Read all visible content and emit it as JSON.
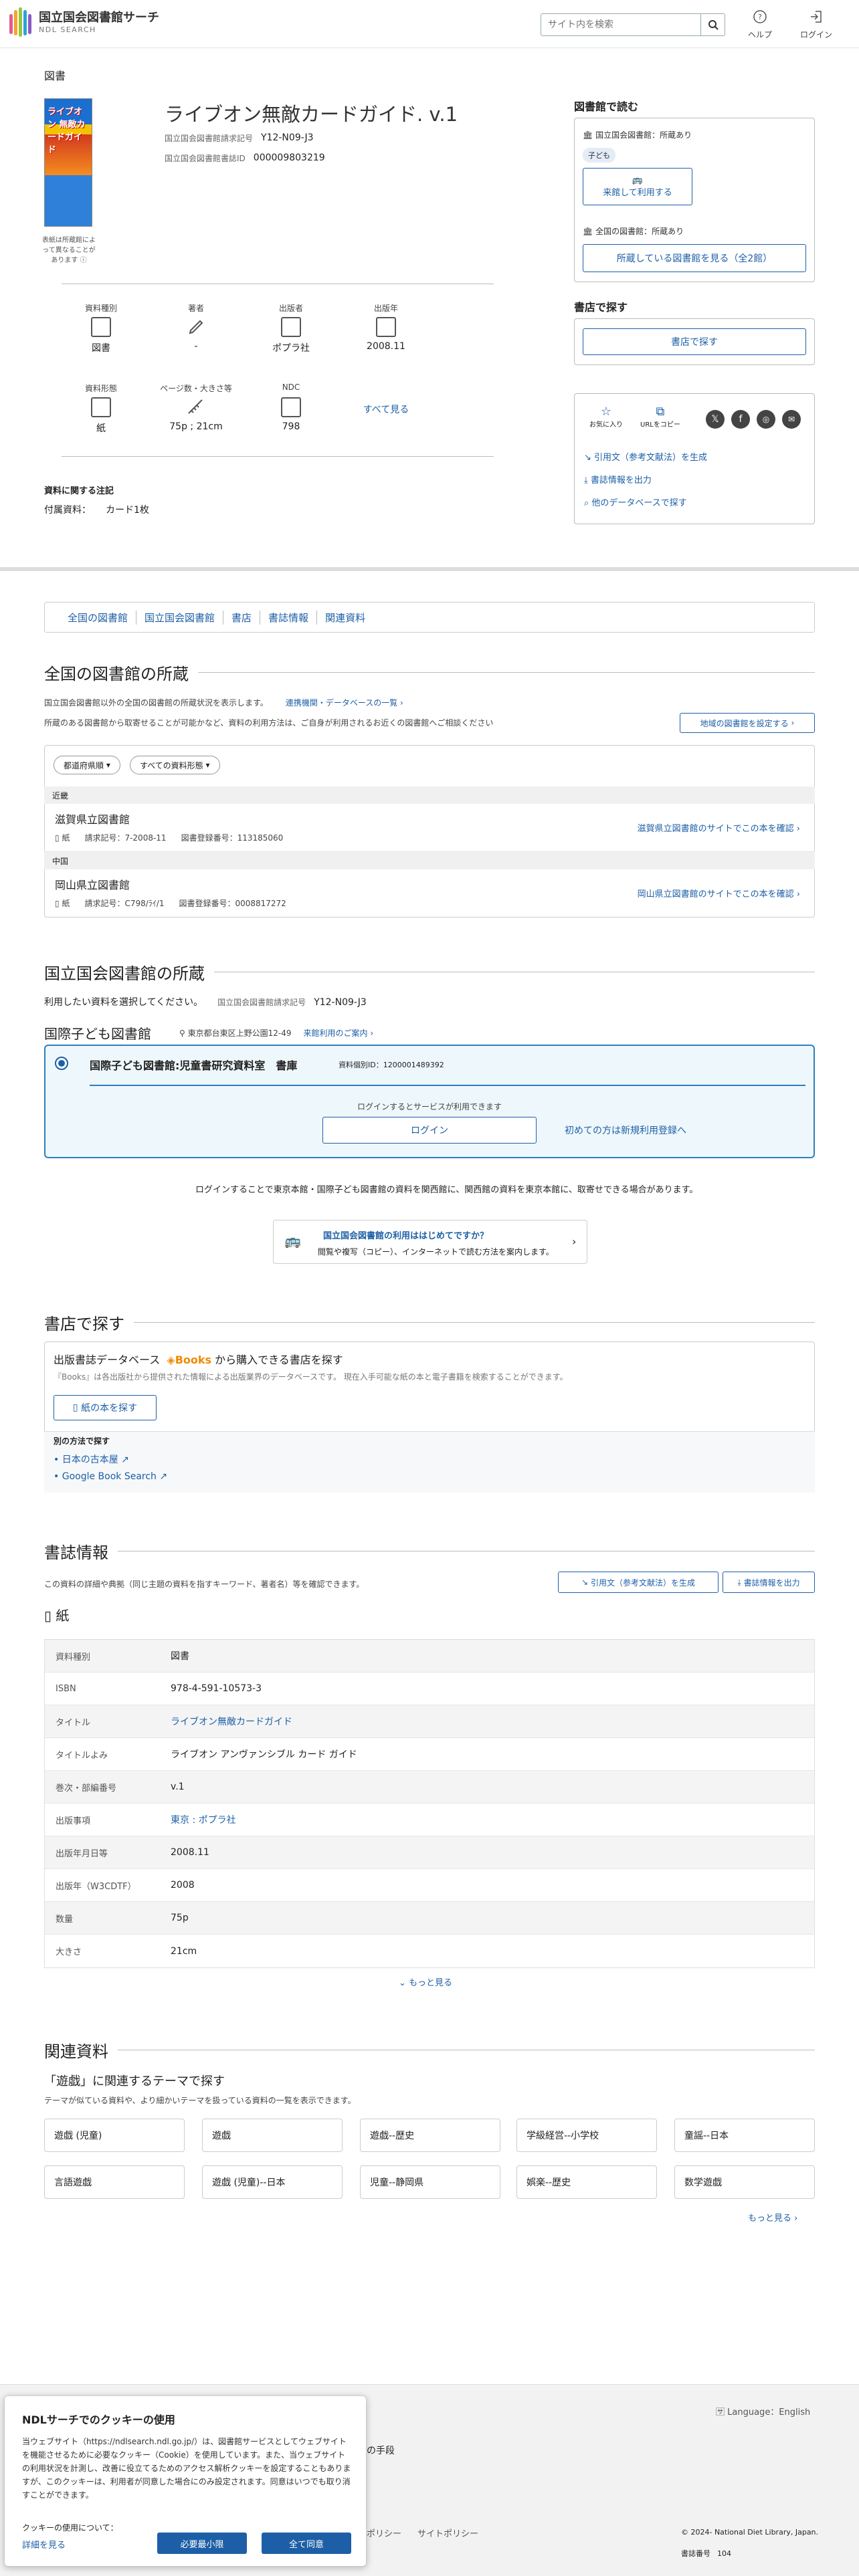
{
  "header": {
    "logo_jp": "国立国会図書館サーチ",
    "logo_en": "NDL SEARCH",
    "search_placeholder": "サイト内を検索",
    "help": "ヘルプ",
    "login": "ログイン"
  },
  "book": {
    "category": "図書",
    "title": "ライブオン無敵カードガイド. v.1",
    "cover_text": "ライブオン 無敵カードガイド",
    "cover_note": "表紙は所蔵館によって異なることがあります",
    "call_label": "国立国会図書館請求記号",
    "call_value": "Y12-N09-J3",
    "bib_label": "国立国会図書館書誌ID",
    "bib_value": "000009803219",
    "stats1": [
      {
        "label": "資料種別",
        "value": "図書"
      },
      {
        "label": "著者",
        "value": "-"
      },
      {
        "label": "出版者",
        "value": "ポプラ社"
      },
      {
        "label": "出版年",
        "value": "2008.11"
      }
    ],
    "stats2": [
      {
        "label": "資料形態",
        "value": "紙"
      },
      {
        "label": "ページ数・大きさ等",
        "value": "75p ; 21cm"
      },
      {
        "label": "NDC",
        "value": "798"
      }
    ],
    "see_all": "すべて見る",
    "notes_heading": "資料に関する注記",
    "notes_key": "付属資料：",
    "notes_value": "カード1枚"
  },
  "sidebar": {
    "read_title": "図書館で読む",
    "ndl_held": "国立国会図書館：所蔵あり",
    "kodomo_badge": "子ども",
    "visit_btn": "来館して利用する",
    "all_held": "全国の図書館：所蔵あり",
    "all_btn": "所蔵している図書館を見る（全2館）",
    "store_title": "書店で探す",
    "store_btn": "書店で探す",
    "fav": "お気に入り",
    "copy_url": "URLをコピー",
    "cite": "引用文（参考文献法）を生成",
    "export": "書誌情報を出力",
    "other_db": "他のデータベースで探す"
  },
  "tabs": [
    "全国の図書館",
    "国立国会図書館",
    "書店",
    "書誌情報",
    "関連資料"
  ],
  "holdings": {
    "title": "全国の図書館の所蔵",
    "desc1": "国立国会図書館以外の全国の図書館の所蔵状況を表示します。",
    "link1": "連携機関・データベースの一覧",
    "desc2": "所蔵のある図書館から取寄せることが可能かなど、資料の利用方法は、ご自身が利用されるお近くの図書館へご相談ください",
    "region_btn": "地域の図書館を設定する",
    "filter1": "都道府県順",
    "filter2": "すべての資料形態",
    "groups": [
      {
        "region": "近畿",
        "name": "滋賀県立図書館",
        "form": "紙",
        "call": "請求記号：7-2008-11",
        "reg": "図書登録番号：113185060",
        "link": "滋賀県立図書館のサイトでこの本を確認"
      },
      {
        "region": "中国",
        "name": "岡山県立図書館",
        "form": "紙",
        "call": "請求記号：C798/ﾗｲ/1",
        "reg": "図書登録番号：0008817272",
        "link": "岡山県立図書館のサイトでこの本を確認"
      }
    ]
  },
  "ndl": {
    "title": "国立国会図書館の所蔵",
    "select_text": "利用したい資料を選択してください。",
    "call_label": "国立国会図書館請求記号",
    "call_value": "Y12-N09-J3",
    "branch": "国際子ども図書館",
    "address": "東京都台東区上野公園12-49",
    "hours": "来館利用のご案内",
    "room": "国際子ども図書館:児童書研究資料室　書庫",
    "item_id": "資料個別ID：1200001489392",
    "login_note": "ログインするとサービスが利用できます",
    "login_btn": "ログイン",
    "register": "初めての方は新規利用登録へ",
    "info": "ログインすることで東京本館・国際子ども図書館の資料を関西館に、関西館の資料を東京本館に、取寄せできる場合があります。",
    "guide_title": "国立国会図書館の利用ははじめてですか？",
    "guide_sub": "閲覧や複写（コピー）、インターネットで読む方法を案内します。"
  },
  "store": {
    "title": "書店で探す",
    "db_pre": "出版書誌データベース",
    "books_logo": "Books",
    "db_post": "から購入できる書店を探す",
    "db_desc": "『Books』は各出版社から提供された情報による出版業界のデータベースです。 現在入手可能な紙の本と電子書籍を検索することができます。",
    "paper_btn": "紙の本を探す",
    "other": "別の方法で探す",
    "links": [
      "日本の古本屋",
      "Google Book Search"
    ]
  },
  "biblio": {
    "title": "書誌情報",
    "desc": "この資料の詳細や典拠（同じ主題の資料を指すキーワード、著者名）等を確認できます。",
    "cite_btn": "引用文（参考文献法）を生成",
    "export_btn": "書誌情報を出力",
    "form": "紙",
    "rows": [
      {
        "k": "資料種別",
        "v": "図書",
        "link": false
      },
      {
        "k": "ISBN",
        "v": "978-4-591-10573-3",
        "link": false
      },
      {
        "k": "タイトル",
        "v": "ライブオン無敵カードガイド",
        "link": true
      },
      {
        "k": "タイトルよみ",
        "v": "ライブオン アンヴァンシブル カード ガイド",
        "link": false
      },
      {
        "k": "巻次・部編番号",
        "v": "v.1",
        "link": false
      },
      {
        "k": "出版事項",
        "v": "東京 : ポプラ社",
        "link": true
      },
      {
        "k": "出版年月日等",
        "v": "2008.11",
        "link": false
      },
      {
        "k": "出版年（W3CDTF）",
        "v": "2008",
        "link": false
      },
      {
        "k": "数量",
        "v": "75p",
        "link": false
      },
      {
        "k": "大きさ",
        "v": "21cm",
        "link": false
      }
    ],
    "more": "もっと見る"
  },
  "related": {
    "title": "関連資料",
    "sub": "「遊戯」に関連するテーマで探す",
    "desc": "テーマが似ている資料や、より細かいテーマを扱っている資料の一覧を表示できます。",
    "topics": [
      "遊戯 (児童)",
      "遊戯",
      "遊戯--歴史",
      "学級経営--小学校",
      "童謡--日本",
      "言語遊戯",
      "遊戯 (児童)--日本",
      "児童--静岡県",
      "娯楽--歴史",
      "数学遊戯"
    ],
    "more": "もっと見る"
  },
  "footer": {
    "lang": "Language：English",
    "fragment1": "の手段",
    "policy1": "ポリシー",
    "policy2": "サイトポリシー",
    "copyright": "© 2024- National Diet Library, Japan.",
    "page_label": "書誌番号",
    "page_num": "104"
  },
  "cookie": {
    "title": "NDLサーチでのクッキーの使用",
    "body": "当ウェブサイト（https://ndlsearch.ndl.go.jp/）は、図書館サービスとしてウェブサイトを機能させるために必要なクッキー（Cookie）を使用しています。また、当ウェブサイトの利用状況を計測し、改善に役立てるためのアクセス解析クッキーを設定することもありますが、このクッキーは、利用者が同意した場合にのみ設定されます。同意はいつでも取り消すことができます。",
    "usage": "クッキーの使用について：",
    "detail": "詳細を見る",
    "btn_required": "必要最小限",
    "btn_all": "全て同意"
  },
  "colors": {
    "accent": "#1d5fa6",
    "login_border": "#2d7fbe"
  }
}
